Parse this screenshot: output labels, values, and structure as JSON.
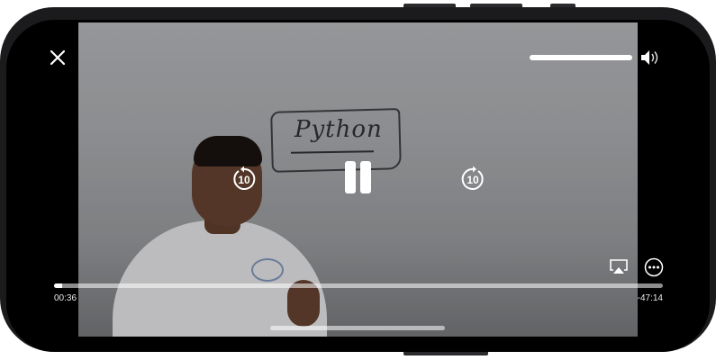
{
  "player": {
    "state": "playing",
    "skip_back_label": "10",
    "skip_forward_label": "10",
    "elapsed_time": "00:36",
    "remaining_time": "-47:14",
    "progress_fraction": 0.0126,
    "volume_fraction": 1.0
  },
  "video_frame": {
    "board_text": "Python"
  },
  "icons": {
    "close": "close-icon",
    "volume": "speaker-volume-icon",
    "skip_back": "skip-back-10-icon",
    "skip_forward": "skip-forward-10-icon",
    "pause": "pause-icon",
    "airplay": "airplay-icon",
    "more": "more-options-icon"
  },
  "colors": {
    "control": "#ffffff",
    "frame": "#1b1b1d",
    "screen_bg": "#000000"
  }
}
